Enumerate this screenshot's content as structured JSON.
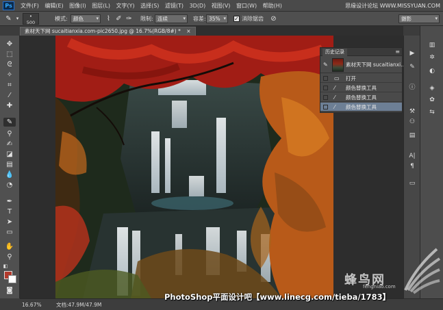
{
  "app": {
    "logo": "Ps"
  },
  "menu": [
    "文件(F)",
    "编辑(E)",
    "图像(I)",
    "图层(L)",
    "文字(Y)",
    "选择(S)",
    "滤镜(T)",
    "3D(D)",
    "视图(V)",
    "窗口(W)",
    "帮助(H)"
  ],
  "watermark_top": "思缘设计论坛 WWW.MISSYUAN.COM",
  "options": {
    "brush_size": "500",
    "mode_label": "模式:",
    "mode_value": "颜色",
    "limits_label": "限制:",
    "limits_value": "连续",
    "tolerance_label": "容差:",
    "tolerance_value": "35%",
    "antialias_label": "消除锯齿",
    "antialias_checked": true,
    "workspace": "摄影"
  },
  "document_tab": {
    "title": "素材天下网 sucaitianxia.com-pic2650.jpg @ 16.7%(RGB/8#) *",
    "close": "×"
  },
  "history": {
    "tab_label": "历史记录",
    "snapshot_label": "素材天下网 sucaitianxi...",
    "rows": [
      {
        "label": "打开",
        "icon": "document-icon",
        "selected": false
      },
      {
        "label": "颜色替换工具",
        "icon": "brush-icon",
        "selected": false
      },
      {
        "label": "颜色替换工具",
        "icon": "brush-icon",
        "selected": false
      },
      {
        "label": "颜色替换工具",
        "icon": "brush-icon",
        "selected": true
      }
    ]
  },
  "status": {
    "zoom": "16.67%",
    "doc_size": "文档:47.9M/47.9M"
  },
  "caption": "PhotoShop平面设计吧【www.linecg.com/tieba/1783】",
  "brand_watermark": "蜂鸟网",
  "brand_url": "fengniao.com",
  "colors": {
    "foreground": "#b23a2c",
    "background": "#ffffff",
    "selection": "#6d7f95"
  }
}
